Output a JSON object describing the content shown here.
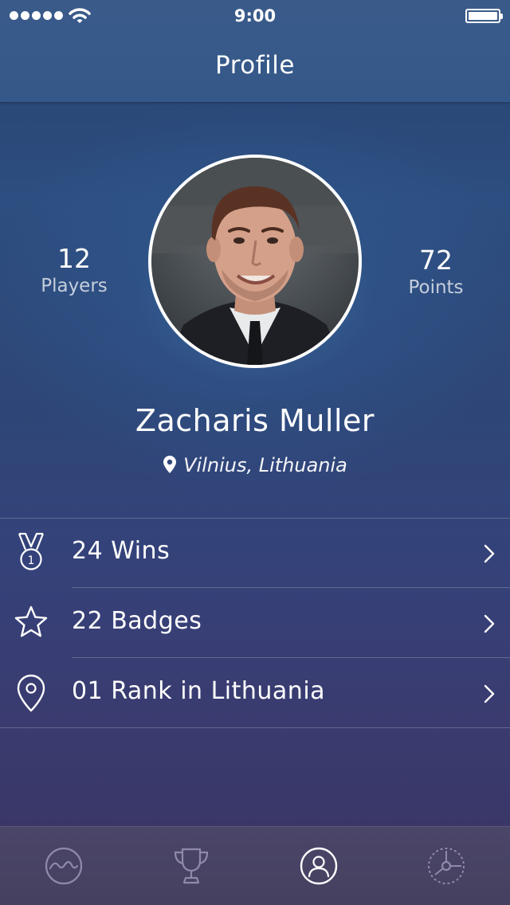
{
  "status_bar": {
    "time": "9:00"
  },
  "nav": {
    "title": "Profile"
  },
  "profile": {
    "players": {
      "count": "12",
      "label": "Players"
    },
    "points": {
      "count": "72",
      "label": "Points"
    },
    "name": "Zacharis Muller",
    "location": "Vilnius, Lithuania"
  },
  "list": [
    {
      "icon": "medal-icon",
      "label": "24 Wins"
    },
    {
      "icon": "star-icon",
      "label": "22 Badges"
    },
    {
      "icon": "location-pin-icon",
      "label": "01 Rank in Lithuania"
    }
  ],
  "tabs": [
    {
      "icon": "activity-wave-icon",
      "active": false
    },
    {
      "icon": "trophy-icon",
      "active": false
    },
    {
      "icon": "user-profile-icon",
      "active": true
    },
    {
      "icon": "settings-dial-icon",
      "active": false
    }
  ],
  "colors": {
    "text": "#ffffff",
    "tab_inactive": "#8f8aa8",
    "tab_active": "#ffffff"
  }
}
